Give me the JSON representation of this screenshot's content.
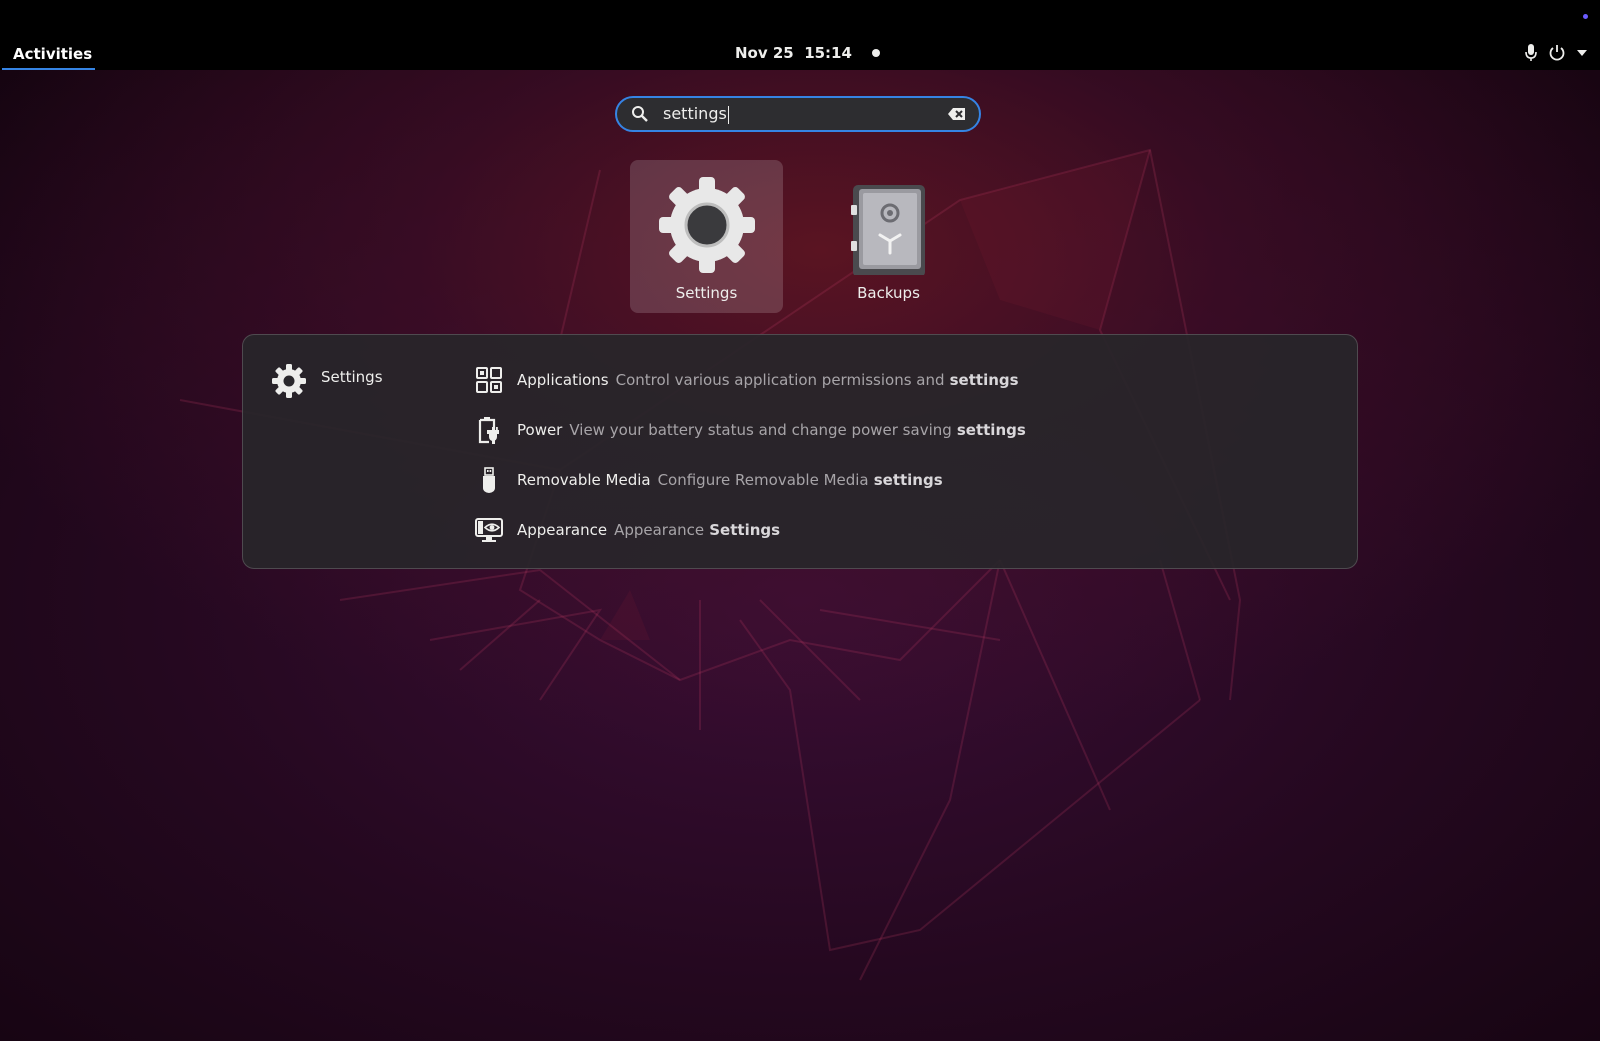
{
  "topbar": {
    "activities_label": "Activities",
    "date": "Nov 25",
    "time": "15:14",
    "icons": [
      "microphone-icon",
      "power-icon",
      "chevron-down-icon"
    ]
  },
  "search": {
    "value": "settings",
    "icon": "search-icon",
    "clear_icon": "clear-icon"
  },
  "apps": [
    {
      "label": "Settings",
      "icon": "settings-gear-icon",
      "selected": true
    },
    {
      "label": "Backups",
      "icon": "backups-safe-icon",
      "selected": false
    }
  ],
  "provider": {
    "label": "Settings",
    "icon": "gear-icon",
    "results": [
      {
        "title": "Applications",
        "desc": "Control various application permissions and",
        "bold": "settings",
        "icon": "applications-icon"
      },
      {
        "title": "Power",
        "desc": "View your battery status and change power saving",
        "bold": "settings",
        "icon": "power-battery-icon"
      },
      {
        "title": "Removable Media",
        "desc": "Configure Removable Media",
        "bold": "settings",
        "icon": "usb-drive-icon"
      },
      {
        "title": "Appearance",
        "desc": "Appearance",
        "bold": "Settings",
        "icon": "appearance-icon"
      }
    ]
  },
  "colors": {
    "accent": "#3584e4",
    "topbar": "#000000",
    "panel": "#28262a",
    "notification_dot": "#6b5cff"
  }
}
